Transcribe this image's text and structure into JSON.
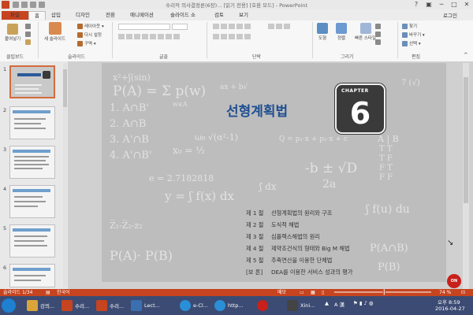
{
  "titlebar": {
    "title": "수리적 의사결정론(6장)... [읽기 전용] [호환 모드] - PowerPoint",
    "minimize": "─",
    "restore": "□",
    "close": "✕"
  },
  "tabs": {
    "file": "파일",
    "home": "홈",
    "insert": "삽입",
    "design": "디자인",
    "transitions": "전환",
    "animations": "애니메이션",
    "slideshow": "슬라이드 쇼",
    "review": "검토",
    "view": "보기",
    "login": "로그인"
  },
  "ribbon": {
    "clipboard": {
      "paste": "붙여넣기",
      "label": "클립보드"
    },
    "slides": {
      "new_slide": "새 슬라이드",
      "layout": "레이아웃 ▾",
      "reset": "다시 설정",
      "section": "구역 ▾",
      "label": "슬라이드"
    },
    "font": {
      "label": "글꼴"
    },
    "paragraph": {
      "label": "단락"
    },
    "drawing": {
      "shapes": "도형",
      "arrange": "정렬",
      "quick_styles": "빠른\n스타일",
      "label": "그리기"
    },
    "editing": {
      "find": "찾기",
      "replace": "바꾸기 ▾",
      "select": "선택 ▾",
      "label": "편집"
    }
  },
  "thumbnails": [
    {
      "number": "1",
      "active": true
    },
    {
      "number": "2",
      "active": false
    },
    {
      "number": "3",
      "active": false
    },
    {
      "number": "4",
      "active": false
    },
    {
      "number": "5",
      "active": false
    },
    {
      "number": "6",
      "active": false
    }
  ],
  "slide": {
    "title": "선형계획법",
    "chapter_word": "CHAPTER",
    "chapter_number": "6",
    "toc": [
      {
        "no": "제 1 절",
        "text": "선형계획법의 원리와 구조"
      },
      {
        "no": "제 2 절",
        "text": "도식적 해법"
      },
      {
        "no": "제 3 절",
        "text": "심플렉스해법의 원리"
      },
      {
        "no": "제 4 절",
        "text": "제약조건식의 형태와 Big  M 해법"
      },
      {
        "no": "제 5 절",
        "text": "추축연산을 이용한 단체법"
      },
      {
        "no": "[보 론]",
        "text": "DEA를 이용한 서비스 성과의 평가"
      }
    ],
    "logo_text": "ON"
  },
  "statusbar": {
    "slide_count": "슬라이드 1/34",
    "language": "한국어",
    "notes": "메모",
    "zoom": "74 %"
  },
  "taskbar": {
    "items": [
      {
        "label": "강의...",
        "color": "#d9a43a"
      },
      {
        "label": "수리...",
        "color": "#c6441f"
      },
      {
        "label": "수리...",
        "color": "#c6441f"
      },
      {
        "label": "Lect...",
        "color": "#3a6fb0"
      },
      {
        "label": "e-Cl...",
        "color": "#2a8fd6"
      },
      {
        "label": "http...",
        "color": "#2a8fd6"
      },
      {
        "label": "Xini...",
        "color": "#444444"
      }
    ],
    "tray_lang": "A 漢",
    "time": "오후 8:59",
    "date": "2016-04-27"
  }
}
